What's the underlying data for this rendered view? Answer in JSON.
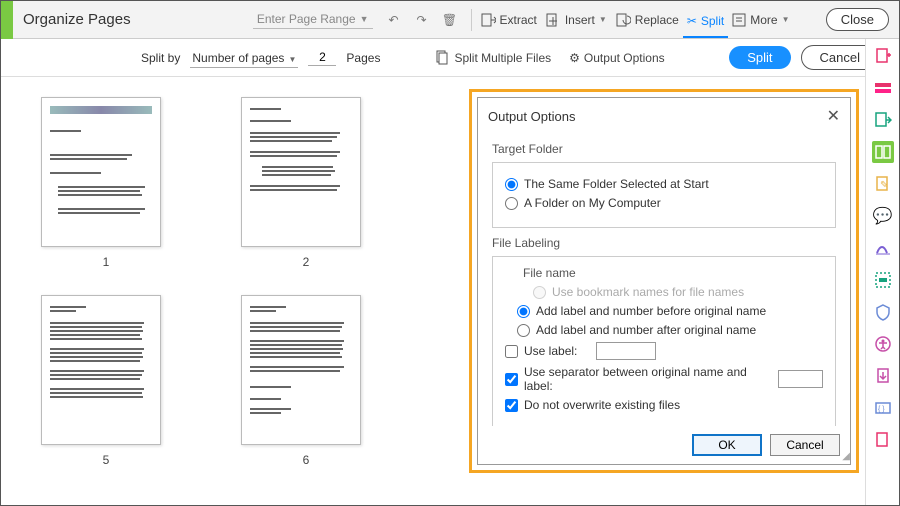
{
  "topbar": {
    "title": "Organize Pages",
    "page_range_placeholder": "Enter Page Range",
    "extract": "Extract",
    "insert": "Insert",
    "replace": "Replace",
    "split": "Split",
    "more": "More",
    "close": "Close"
  },
  "subbar": {
    "split_by": "Split by",
    "mode": "Number of pages",
    "count": "2",
    "pages_label": "Pages",
    "split_multiple": "Split Multiple Files",
    "output_options": "Output Options",
    "split_btn": "Split",
    "cancel_btn": "Cancel"
  },
  "thumbs": [
    "1",
    "2",
    "5",
    "6"
  ],
  "dialog": {
    "title": "Output Options",
    "target_folder": "Target Folder",
    "same_folder": "The Same Folder Selected at Start",
    "my_computer": "A Folder on My Computer",
    "file_labeling": "File Labeling",
    "file_name": "File name",
    "bookmark_names": "Use bookmark names for file names",
    "label_before": "Add label and number before original name",
    "label_after": "Add label and number after original name",
    "use_label": "Use label:",
    "use_separator": "Use separator between original name and label:",
    "no_overwrite": "Do not overwrite existing files",
    "ok": "OK",
    "cancel": "Cancel"
  }
}
